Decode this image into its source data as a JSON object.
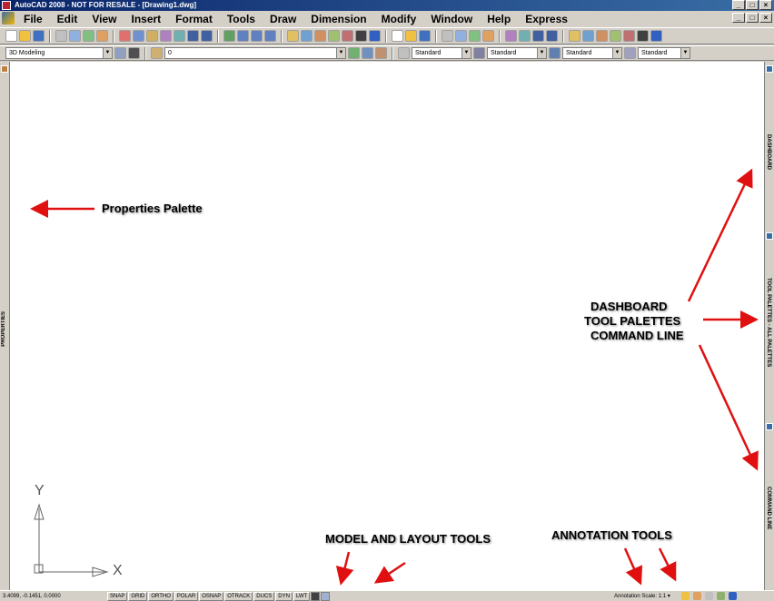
{
  "window": {
    "title": "AutoCAD 2008 - NOT FOR RESALE - [Drawing1.dwg]",
    "controls": [
      "_",
      "□",
      "×"
    ]
  },
  "menubar": {
    "items": [
      "File",
      "Edit",
      "View",
      "Insert",
      "Format",
      "Tools",
      "Draw",
      "Dimension",
      "Modify",
      "Window",
      "Help",
      "Express"
    ],
    "mdi_controls": [
      "_",
      "□",
      "×"
    ]
  },
  "toolbar2": {
    "workspace": "3D Modeling",
    "layer": "0",
    "text_style": "Standard",
    "dim_style": "Standard",
    "table_style": "Standard",
    "multileader_style": "Standard"
  },
  "palettes": {
    "left_label": "PROPERTIES",
    "right_labels": [
      "DASHBOARD",
      "TOOL PALETTES - ALL PALETTES",
      "COMMAND LINE"
    ]
  },
  "annotations": {
    "properties_palette": "Properties Palette",
    "right_group": [
      "DASHBOARD",
      "TOOL PALETTES",
      "COMMAND LINE"
    ],
    "model_layout": "MODEL AND LAYOUT TOOLS",
    "annotation_tools": "ANNOTATION TOOLS"
  },
  "ucs": {
    "x_label": "X",
    "y_label": "Y"
  },
  "statusbar": {
    "coordinates": "3.4099, -0.1451, 0.0000",
    "toggles": [
      "SNAP",
      "GRID",
      "ORTHO",
      "POLAR",
      "OSNAP",
      "OTRACK",
      "DUCS",
      "DYN",
      "LWT"
    ],
    "annotation_scale_label": "Annotation Scale:",
    "annotation_scale_value": "1:1 ▾"
  },
  "colors": {
    "arrow": "#e01010",
    "titlebar": "#0a246a",
    "chrome": "#d4d0c8"
  }
}
